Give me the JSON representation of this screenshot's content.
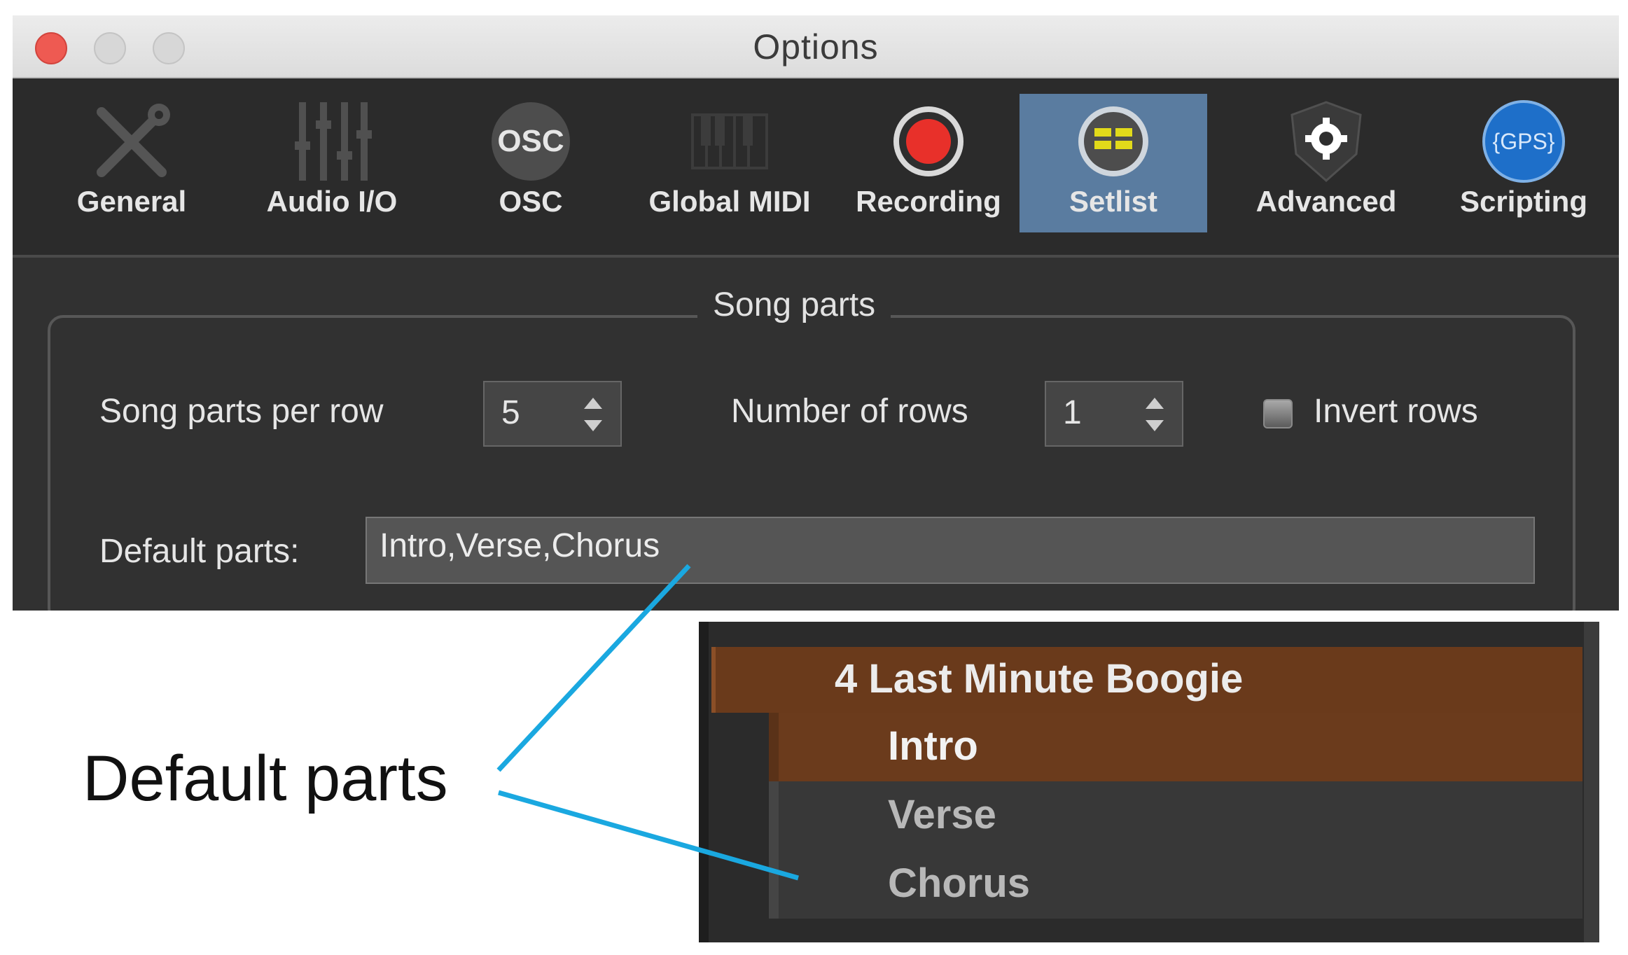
{
  "window": {
    "title": "Options"
  },
  "toolbar": {
    "items": [
      {
        "label": "General",
        "icon": "wrench-screwdriver-icon"
      },
      {
        "label": "Audio I/O",
        "icon": "mixer-faders-icon"
      },
      {
        "label": "OSC",
        "icon": "osc-icon",
        "icon_text": "OSC"
      },
      {
        "label": "Global MIDI",
        "icon": "keyboard-icon"
      },
      {
        "label": "Recording",
        "icon": "record-icon"
      },
      {
        "label": "Setlist",
        "icon": "setlist-icon",
        "active": true
      },
      {
        "label": "Advanced",
        "icon": "gear-shield-icon"
      },
      {
        "label": "Scripting",
        "icon": "gps-icon",
        "icon_text": "{GPS}"
      }
    ]
  },
  "song_parts": {
    "group_title": "Song parts",
    "per_row_label": "Song parts per row",
    "per_row_value": "5",
    "rows_label": "Number of rows",
    "rows_value": "1",
    "invert_rows_label": "Invert rows",
    "invert_rows_checked": false,
    "default_parts_label": "Default parts:",
    "default_parts_value": "Intro,Verse,Chorus"
  },
  "setlist_preview": {
    "song_title": "4 Last Minute Boogie",
    "parts": [
      {
        "label": "Intro",
        "selected": true
      },
      {
        "label": "Verse",
        "selected": false
      },
      {
        "label": "Chorus",
        "selected": false
      }
    ]
  },
  "callout": {
    "label": "Default parts",
    "line_color": "#1aa8e0"
  },
  "colors": {
    "active_tab": "#5a7ca0",
    "record_red": "#e8302a",
    "setlist_yellow": "#d9d21c",
    "scripting_blue": "#1e6fc9",
    "selected_row": "#6a3a1b"
  }
}
